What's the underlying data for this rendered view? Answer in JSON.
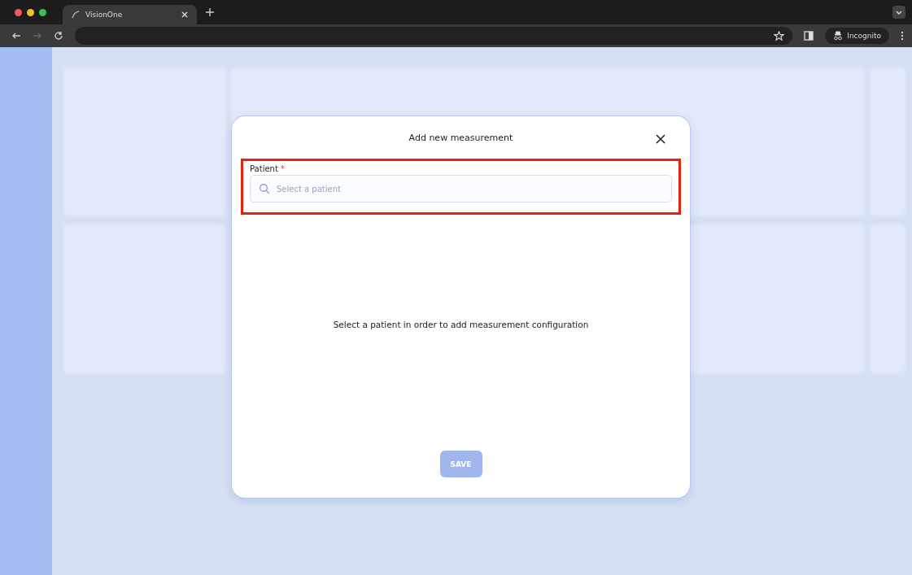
{
  "browser": {
    "tab": {
      "title": "VisionOne",
      "selected": true
    },
    "profile_label": "Incognito"
  },
  "dialog": {
    "title": "Add new measurement",
    "field": {
      "label": "Patient",
      "required_mark": "*",
      "placeholder": "Select a patient",
      "highlighted": true
    },
    "message": "Select a patient in order to add measurement configuration",
    "save_button": {
      "label": "SAVE",
      "disabled": true
    }
  }
}
